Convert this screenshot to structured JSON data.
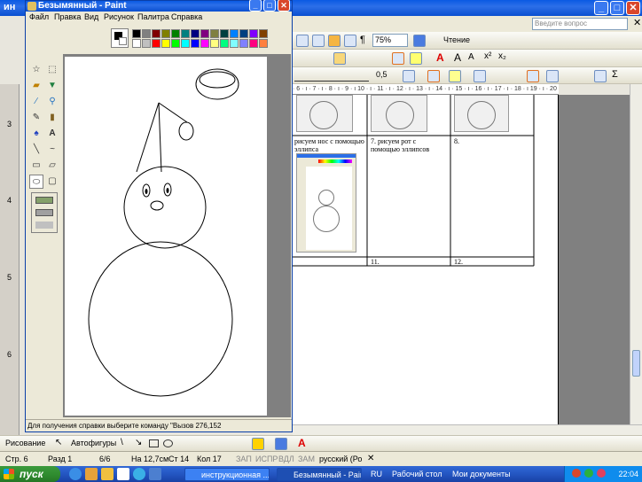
{
  "word": {
    "title": "ин",
    "search_placeholder": "Введите вопрос",
    "zoom": "75%",
    "read_button": "Чтение",
    "line_width": "0,5",
    "ruler_left_numbers": [
      "3",
      "4",
      "5",
      "6"
    ],
    "ruler_top": "· 6 · ı · 7 · ı · 8 · ı · 9 · ı 10 · ı · 11 · ı · 12 · ı · 13 · ı · 14 · ı · 15 · ı · 16 · ı · 17 · ı · 18 · ı 19 · ı · 20",
    "table": {
      "cell_6": "рисуем нос с помощью эллипса",
      "cell_7": "7. рисуем рот с помощью эллипсов",
      "cell_8": "8.",
      "cell_11": "11.",
      "cell_12": "12."
    },
    "drawing_toolbar": {
      "draw_label": "Рисование",
      "autoshapes_label": "Автофигуры"
    },
    "status": {
      "page": "Стр. 6",
      "section": "Разд 1",
      "pages": "6/6",
      "at": "На 12,7см",
      "line": "Ст 14",
      "col": "Кол 17",
      "rec": "ЗАП",
      "trk": "ИСПР",
      "ext": "ВДЛ",
      "ovr": "ЗАМ",
      "lang": "русский (Ро"
    }
  },
  "paint": {
    "title": "Безымянный - Paint",
    "menu": [
      "Файл",
      "Правка",
      "Вид",
      "Рисунок",
      "Палитра",
      "Справка"
    ],
    "status": "Для получения справки выберите команду \"Вызов  276,152",
    "palette_top": [
      "#000000",
      "#808080",
      "#800000",
      "#808000",
      "#008000",
      "#008080",
      "#000080",
      "#800080",
      "#808040",
      "#004040",
      "#0080ff",
      "#004080",
      "#8000ff",
      "#804000"
    ],
    "palette_bottom": [
      "#ffffff",
      "#c0c0c0",
      "#ff0000",
      "#ffff00",
      "#00ff00",
      "#00ffff",
      "#0000ff",
      "#ff00ff",
      "#ffff80",
      "#00ff80",
      "#80ffff",
      "#8080ff",
      "#ff0080",
      "#ff8040"
    ],
    "tools": [
      "free-select-icon",
      "rect-select-icon",
      "eraser-icon",
      "fill-icon",
      "picker-icon",
      "magnifier-icon",
      "pencil-icon",
      "brush-icon",
      "airbrush-icon",
      "text-icon",
      "line-icon",
      "curve-icon",
      "rectangle-icon",
      "polygon-icon",
      "ellipse-icon",
      "rounded-rect-icon"
    ]
  },
  "taskbar": {
    "start": "пуск",
    "buttons": [
      "инструкционная ...",
      "Безымянный - Paint"
    ],
    "lang": "RU",
    "desktop": "Рабочий стол",
    "mydocs": "Мои документы",
    "time": "22:04"
  }
}
